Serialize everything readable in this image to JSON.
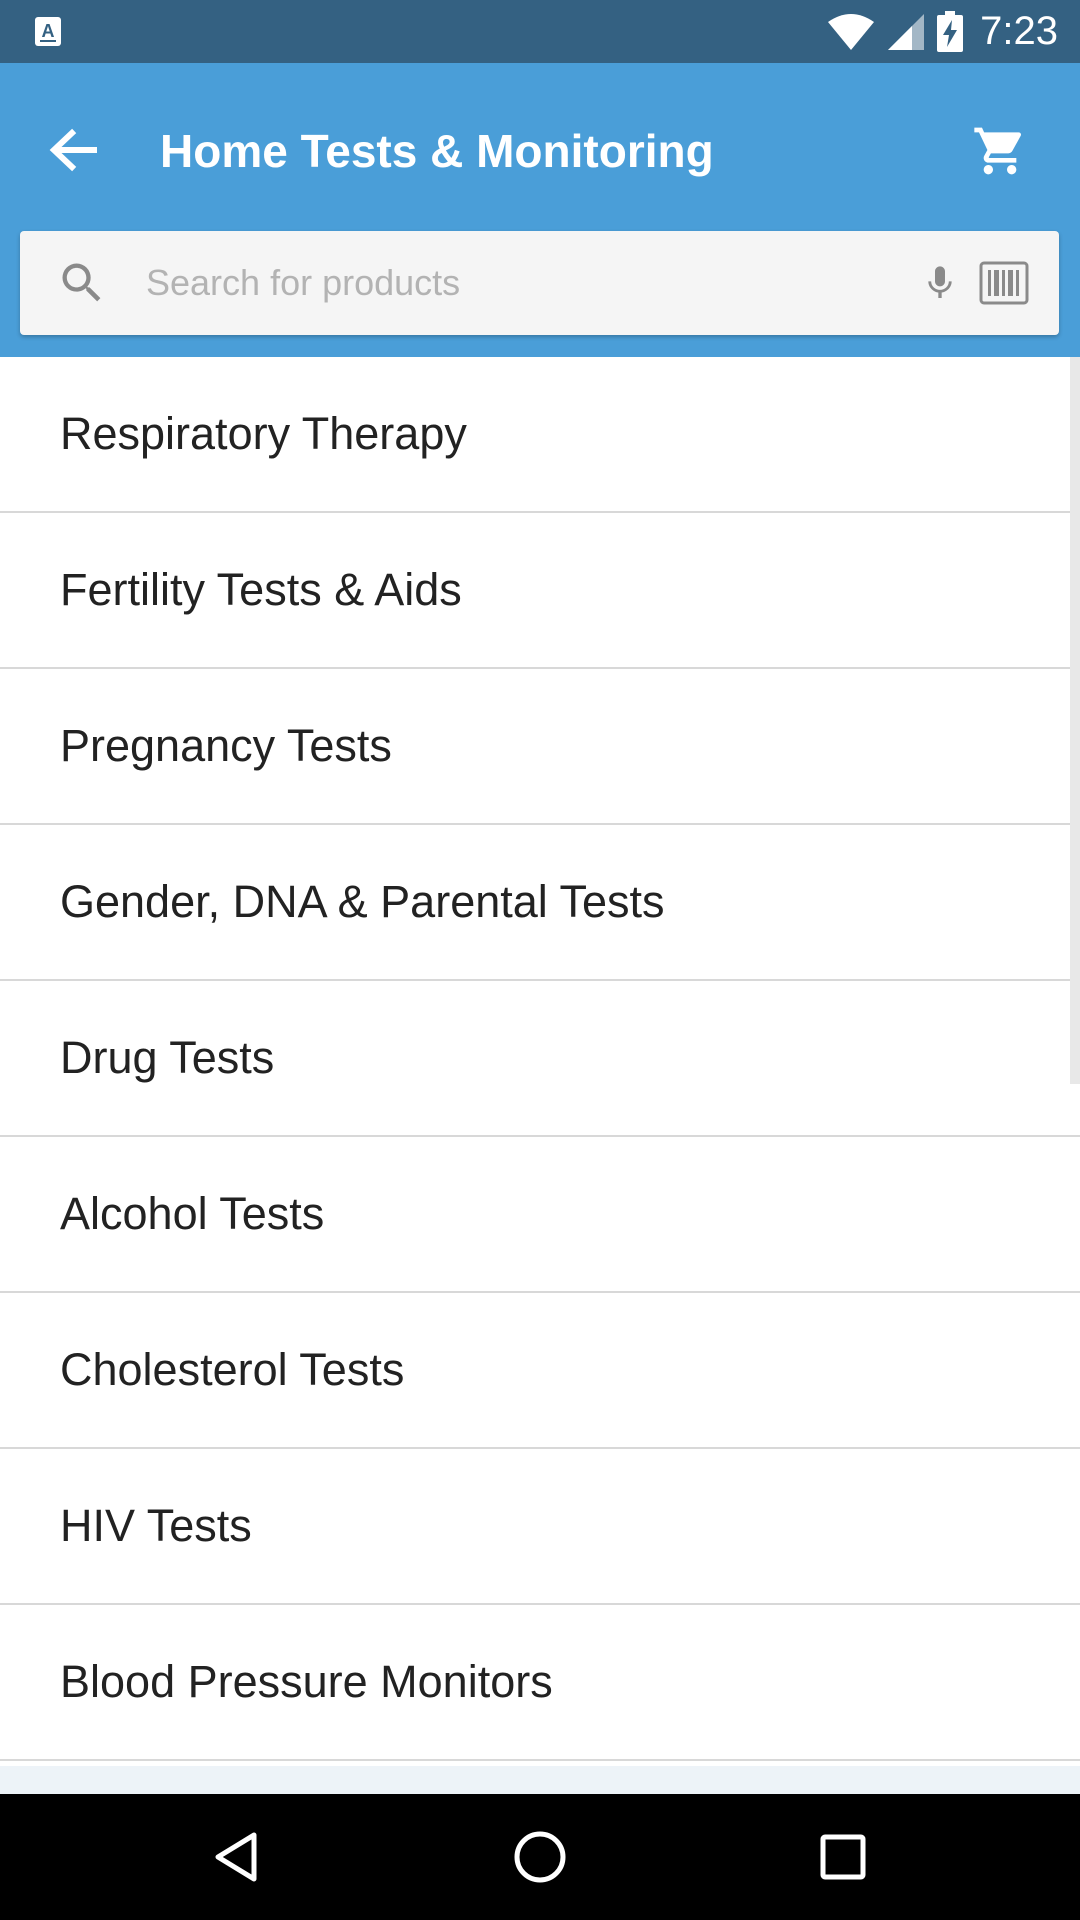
{
  "status_bar": {
    "time": "7:23",
    "app_indicator_icon": "a-notification-icon",
    "wifi_icon": "wifi-icon",
    "signal_icon": "cell-signal-icon",
    "battery_icon": "battery-charging-icon"
  },
  "app_bar": {
    "title": "Home Tests & Monitoring",
    "back_icon": "arrow-left-icon",
    "cart_icon": "shopping-cart-icon"
  },
  "search": {
    "value": "",
    "placeholder": "Search for products",
    "search_icon": "search-icon",
    "mic_icon": "microphone-icon",
    "barcode_icon": "barcode-icon"
  },
  "categories": [
    {
      "label": "Respiratory Therapy"
    },
    {
      "label": "Fertility Tests & Aids"
    },
    {
      "label": "Pregnancy Tests"
    },
    {
      "label": "Gender, DNA & Parental Tests"
    },
    {
      "label": "Drug Tests"
    },
    {
      "label": "Alcohol Tests"
    },
    {
      "label": "Cholesterol Tests"
    },
    {
      "label": "HIV Tests"
    },
    {
      "label": "Blood Pressure Monitors"
    }
  ],
  "nav_bar": {
    "back_icon": "nav-back-triangle-icon",
    "home_icon": "nav-home-circle-icon",
    "recents_icon": "nav-recents-square-icon"
  },
  "colors": {
    "status_bar": "#346182",
    "app_bar": "#4a9ed8",
    "search_box": "#f5f5f5",
    "divider": "#d8d8d8",
    "text_primary": "#222222",
    "placeholder": "#b3b3b3",
    "nav_bar": "#000000"
  }
}
